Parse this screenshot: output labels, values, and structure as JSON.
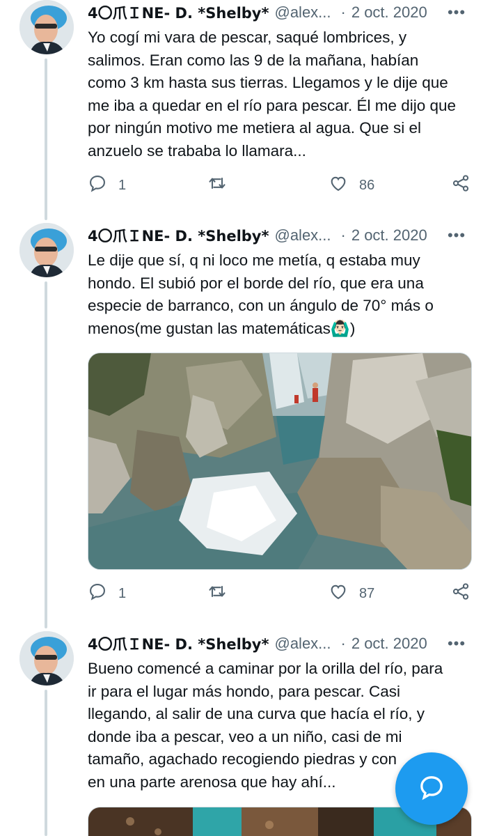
{
  "tweets": [
    {
      "display_name": "4〇爪ＩNE- D. *Shelby*",
      "handle": "@alex...",
      "separator": "·",
      "date": "2 oct. 2020",
      "text": "Yo cogí mi vara de pescar, saqué lombrices, y\nsalimos. Eran como las 9 de la mañana, habían\ncomo 3 km hasta sus tierras. Llegamos y le dije que\nme iba a quedar en el río para pescar. Él me dijo que\npor ningún motivo me metiera al agua. Que si el\nanzuelo se trababa lo llamara...",
      "reply_count": "1",
      "like_count": "86"
    },
    {
      "display_name": "4〇爪ＩNE- D. *Shelby*",
      "handle": "@alex...",
      "separator": "·",
      "date": "2 oct. 2020",
      "text": "Le dije que sí, q ni loco me metía, q estaba muy\nhondo. El subió por el borde del río, que era una\nespecie de barranco, con un ángulo de 70° más o\nmenos(me gustan las matemáticas🙆🏻‍♂️)",
      "reply_count": "1",
      "like_count": "87"
    },
    {
      "display_name": "4〇爪ＩNE- D. *Shelby*",
      "handle": "@alex...",
      "separator": "·",
      "date": "2 oct. 2020",
      "text": "Bueno comencé a caminar por la orilla del río, para\nir para el lugar más hondo, para pescar. Casi\nllegando, al salir de una curva que hacía el río, y\ndonde iba a pescar, veo a un niño, casi de mi\ntamaño, agachado recogiendo piedras y con\nen una parte arenosa que hay ahí..."
    }
  ],
  "more_glyph": "•••",
  "icons": {
    "reply": "reply-icon",
    "retweet": "retweet-icon",
    "like": "heart-icon",
    "share": "share-icon",
    "compose": "compose-message-icon"
  },
  "colors": {
    "accent": "#1d9bf0",
    "secondary_text": "#536471",
    "thread_line": "#cfd9de"
  }
}
